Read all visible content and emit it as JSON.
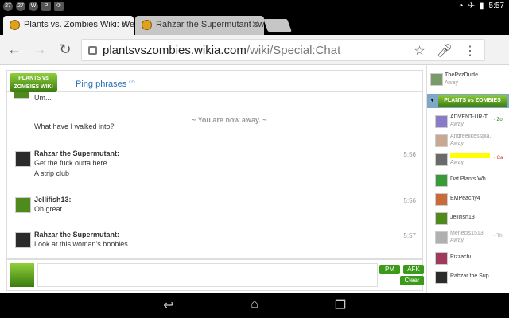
{
  "status_bar": {
    "left_icons": [
      "27",
      "27",
      "W",
      "P",
      "sync"
    ],
    "time": "5:57"
  },
  "tabs": [
    {
      "label": "Plants vs. Zombies Wiki: We",
      "active": true
    },
    {
      "label": "Rahzar the Supermutant sw",
      "active": false
    }
  ],
  "toolbar": {
    "url_host": "plantsvszombies.wikia.com",
    "url_path": "/wiki/Special:Chat"
  },
  "chat": {
    "header_logo": "PLANTS vs ZOMBIES WIKI",
    "ping_label": "Ping phrases",
    "ping_help": "(?)",
    "messages": [
      {
        "text": "Um..."
      },
      {
        "text": "What have I walked into?"
      },
      {
        "away": "~ You are now away. ~"
      },
      {
        "name": "Rahzar the Supermutant:",
        "time": "5:56",
        "lines": [
          "Get the fuck outta here.",
          "A strip club"
        ]
      },
      {
        "name": "Jellifish13:",
        "time": "5:56",
        "lines": [
          "Oh great..."
        ]
      },
      {
        "name": "Rahzar the Supermutant:",
        "time": "5:57",
        "lines": [
          "Look at this woman's boobies"
        ]
      }
    ],
    "buttons": {
      "pm": "PM",
      "afk": "AFK",
      "clear": "Clear"
    }
  },
  "sidebar": {
    "self": {
      "name": "ThePvzDude",
      "status": "Away"
    },
    "room_logo": "PLANTS vs ZOMBIES WIKI",
    "users": [
      {
        "name": "ADVENT-UR-T...",
        "status": "Away",
        "extra": "- Zo"
      },
      {
        "name": "Andreelikesspla...",
        "status": "Away",
        "extra": ""
      },
      {
        "name": "",
        "status": "Away",
        "extra": "- Ca"
      },
      {
        "name": "Dat Plants Wh...",
        "status": "",
        "extra": ""
      },
      {
        "name": "EMPeachy4",
        "status": "",
        "extra": ""
      },
      {
        "name": "Jellifish13",
        "status": "",
        "extra": ""
      },
      {
        "name": "Menecis1513",
        "status": "Away",
        "extra": "- Th"
      },
      {
        "name": "Pizzachu",
        "status": "",
        "extra": ""
      },
      {
        "name": "Rahzar the Sup...",
        "status": "",
        "extra": ""
      }
    ]
  }
}
